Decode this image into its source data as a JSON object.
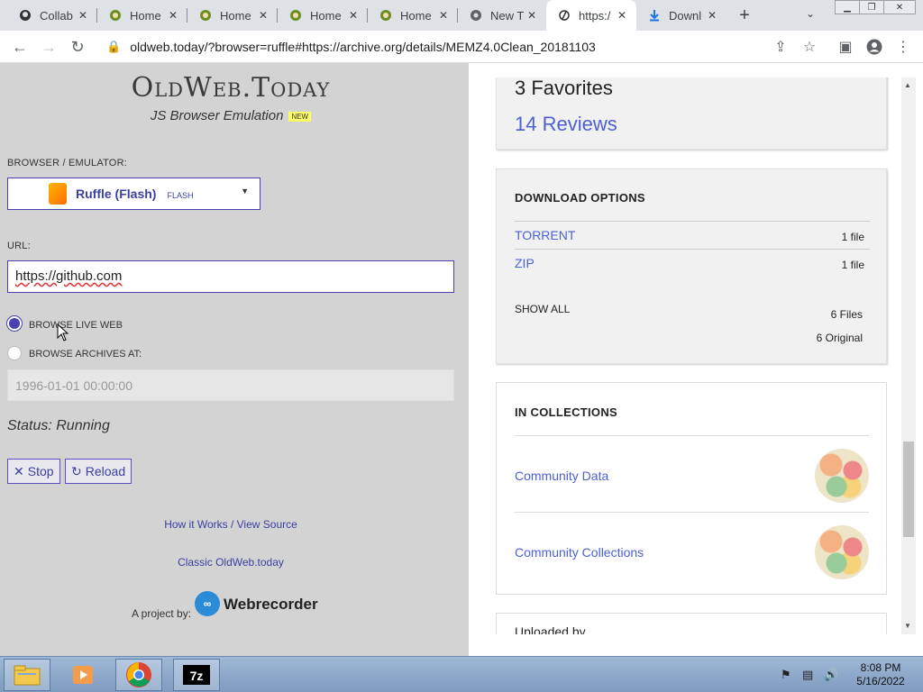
{
  "browser": {
    "tabs": [
      {
        "label": "Collab",
        "icon": "github-icon"
      },
      {
        "label": "Home",
        "icon": "home-icon"
      },
      {
        "label": "Home",
        "icon": "home-icon"
      },
      {
        "label": "Home",
        "icon": "home-icon"
      },
      {
        "label": "Home",
        "icon": "home-icon"
      },
      {
        "label": "New T",
        "icon": "chrome-icon"
      },
      {
        "label": "https:/",
        "icon": "oldweb-icon",
        "active": true
      },
      {
        "label": "Downl",
        "icon": "download-icon"
      }
    ],
    "address": "oldweb.today/?browser=ruffle#https://archive.org/details/MEMZ4.0Clean_20181103"
  },
  "left": {
    "logo": "OldWeb.Today",
    "subtitle": "JS Browser Emulation",
    "new_badge": "NEW",
    "emulator_label": "BROWSER / EMULATOR:",
    "emulator_value": "Ruffle (Flash)",
    "emulator_sub": "FLASH",
    "url_label": "URL:",
    "url_value": "https://github.com",
    "radio_live": "BROWSE LIVE WEB",
    "radio_archives": "BROWSE ARCHIVES AT:",
    "date_placeholder": "1996-01-01 00:00:00",
    "status": "Status: Running",
    "stop_label": "Stop",
    "reload_label": "Reload",
    "how_link": "How it Works / View Source",
    "classic_link": "Classic OldWeb.today",
    "project_label": "A project by:",
    "webrecorder": "Webrecorder"
  },
  "right": {
    "favorites": "3 Favorites",
    "reviews": "14 Reviews",
    "download_title": "DOWNLOAD OPTIONS",
    "downloads": [
      {
        "name": "TORRENT",
        "count": "1 file"
      },
      {
        "name": "ZIP",
        "count": "1 file"
      }
    ],
    "show_all": "SHOW ALL",
    "files_count": "6 Files",
    "original_count": "6 Original",
    "collections_title": "IN COLLECTIONS",
    "collections": [
      {
        "name": "Community Data"
      },
      {
        "name": "Community Collections"
      }
    ],
    "uploaded_by": "Uploaded by"
  },
  "taskbar": {
    "time": "8:08 PM",
    "date": "5/16/2022"
  }
}
